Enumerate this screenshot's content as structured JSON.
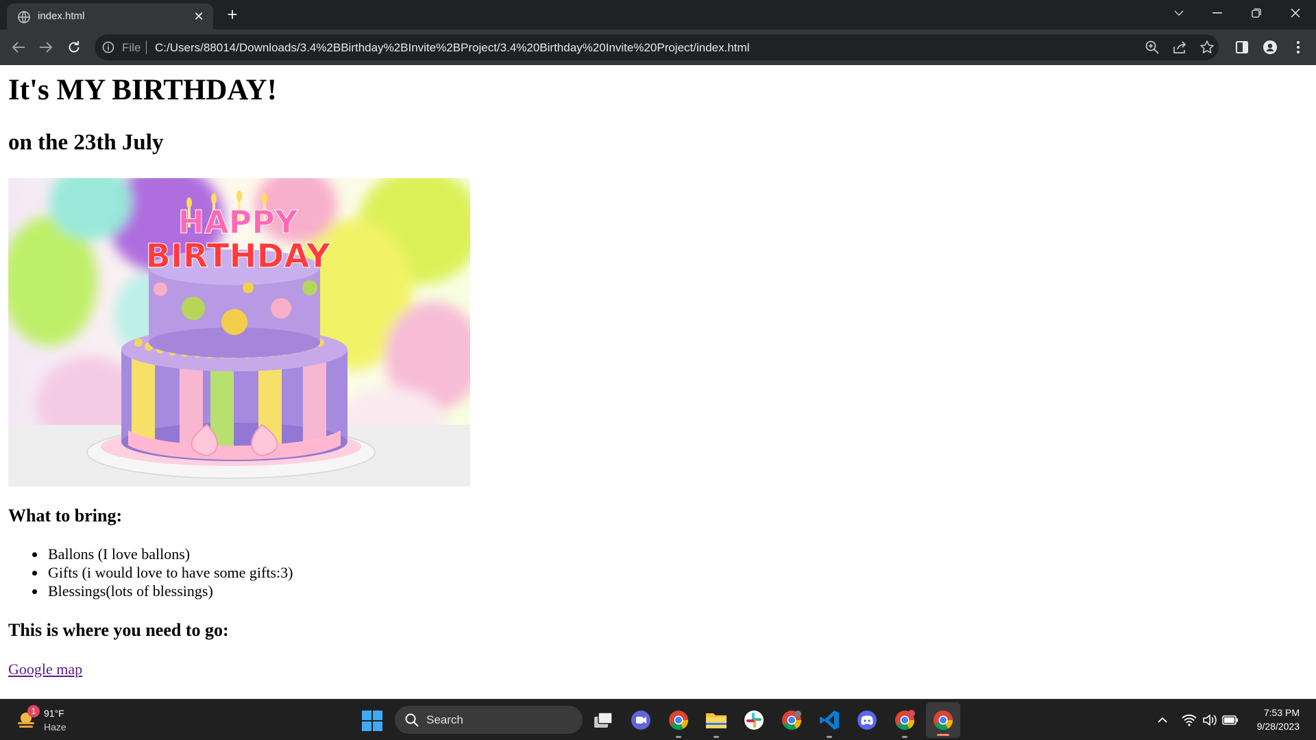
{
  "browser": {
    "tab_title": "index.html",
    "tab_close": "✕",
    "new_tab": "+",
    "scheme_label": "File",
    "url": "C:/Users/88014/Downloads/3.4%2BBirthday%2BInvite%2BProject/3.4%20Birthday%20Invite%20Project/index.html"
  },
  "page": {
    "heading": "It's MY BIRTHDAY!",
    "date": "on the 23th July",
    "image_text": {
      "line1": "HAPPY",
      "line2": "BIRTHDAY"
    },
    "bring_heading": "What to bring:",
    "bring_items": [
      "Ballons (I love ballons)",
      "Gifts (i would love to have some gifts:3)",
      "Blessings(lots of blessings)"
    ],
    "where_heading": "This is where you need to go:",
    "map_link": "Google map"
  },
  "taskbar": {
    "weather_temp": "91°F",
    "weather_desc": "Haze",
    "weather_badge": "1",
    "search_label": "Search",
    "time": "7:53 PM",
    "date": "9/28/2023"
  },
  "icons": [
    "globe-icon",
    "close-icon",
    "plus-icon",
    "chevron-down-icon",
    "minimize-icon",
    "restore-icon",
    "window-close-icon",
    "back-arrow-icon",
    "forward-arrow-icon",
    "reload-icon",
    "info-icon",
    "zoom-icon",
    "share-icon",
    "star-icon",
    "side-panel-icon",
    "profile-icon",
    "more-vert-icon",
    "windows-start-icon",
    "search-icon",
    "task-view-icon",
    "teams-chat-icon",
    "chrome-icon",
    "file-explorer-icon",
    "slack-icon",
    "vscode-icon",
    "discord-icon",
    "chevron-up-icon",
    "wifi-icon",
    "volume-icon",
    "battery-icon"
  ],
  "colors": {
    "tabstrip_bg": "#202124",
    "toolbar_bg": "#35363a",
    "omnibox_bg": "#202124",
    "taskbar_bg": "#202020",
    "visited_link": "#551a8b",
    "weather_badge": "#e0465e"
  }
}
